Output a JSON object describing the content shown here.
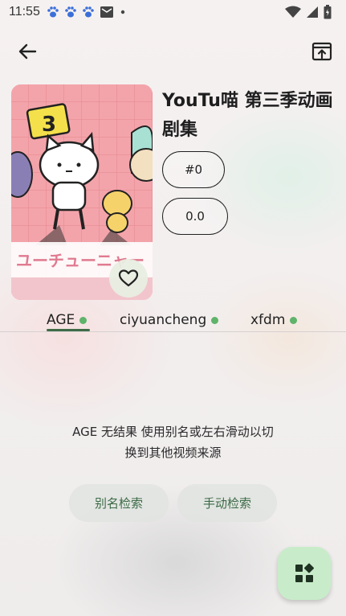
{
  "status_bar": {
    "time": "11:55"
  },
  "anime": {
    "title": "YouTu喵 第三季动画剧集",
    "episode_chip": "#0",
    "rating_chip": "0.0",
    "poster_text": "ユーチューニャー",
    "poster_number": "3"
  },
  "sources": {
    "tabs": [
      {
        "label": "AGE",
        "status_color": "#5fb36a"
      },
      {
        "label": "ciyuancheng",
        "status_color": "#5fb36a"
      },
      {
        "label": "xfdm",
        "status_color": "#5fb36a"
      }
    ]
  },
  "result": {
    "message_line1": "AGE 无结果 使用别名或左右滑动以切",
    "message_line2": "换到其他视频来源",
    "alias_search_label": "别名检索",
    "manual_search_label": "手动检索"
  },
  "colors": {
    "accent": "#3d6b47",
    "fab_bg": "#c8ecc9",
    "online_dot": "#5fb36a"
  }
}
